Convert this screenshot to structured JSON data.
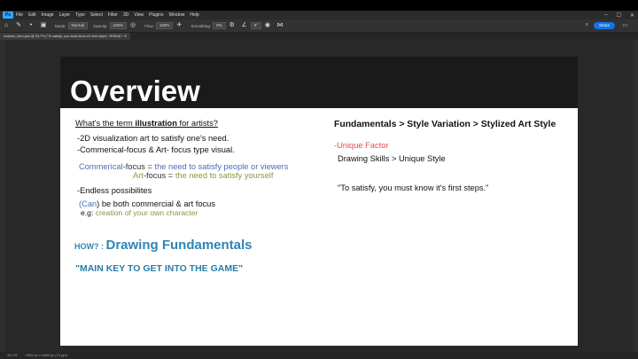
{
  "menu": [
    "File",
    "Edit",
    "Image",
    "Layer",
    "Type",
    "Select",
    "Filter",
    "3D",
    "View",
    "Plugins",
    "Window",
    "Help"
  ],
  "app_logo": "Ps",
  "options": {
    "mode_label": "Mode:",
    "mode_value": "Normal",
    "opacity_label": "Opacity:",
    "opacity_value": "100%",
    "flow_label": "Flow:",
    "flow_value": "100%",
    "smoothing_label": "Smoothing:",
    "smoothing_value": "0%",
    "angle_value": "0°",
    "share_label": "Share"
  },
  "document_tab": "revision_intro.psd @ 33.7% (\"To satisfy, you must know it's first steps\", RGB/8) *",
  "status": {
    "zoom": "33.7%",
    "doc_info": "1920 px x 1080 px (72 ppi)"
  },
  "slide": {
    "title": "Overview",
    "question_prefix": "What's the term ",
    "question_bold": "illustration",
    "question_suffix": " for artists?",
    "bullet1": "-2D visualization art to satisfy one's need.",
    "bullet2": "-Commerical-focus & Art- focus type visual.",
    "commercial_prefix": "Commerical",
    "commercial_suffix": "-focus = ",
    "commercial_def": "the need to satisfy people or viewers",
    "art_prefix": "Art",
    "art_suffix": "-focus = ",
    "art_def": "the need to satisfy yourself",
    "bullet3": "-Endless possibilites",
    "can_open": "(",
    "can_word": "Can",
    "can_rest": ") be both commercial & art focus",
    "eg_prefix": "e.g: ",
    "eg_text": "creation of your own character",
    "how_label": "HOW? : ",
    "how_text": "Drawing Fundamentals",
    "main_key": "\"MAIN KEY TO GET INTO THE GAME\"",
    "right_heading": "Fundamentals > Style Variation >  Stylized Art Style",
    "unique_factor": "-Unique Factor",
    "skills_line": "Drawing Skills > Unique Style",
    "quote": "\"To satisfy, you must know it's first steps.\""
  },
  "colors": {
    "photoshop_blue": "#31a8ff",
    "share_button": "#1473e6",
    "commercial_blue": "#4a6fb5",
    "art_green": "#7f9a3f",
    "unique_red": "#e05050",
    "fundamentals_teal": "#2e86b4"
  }
}
